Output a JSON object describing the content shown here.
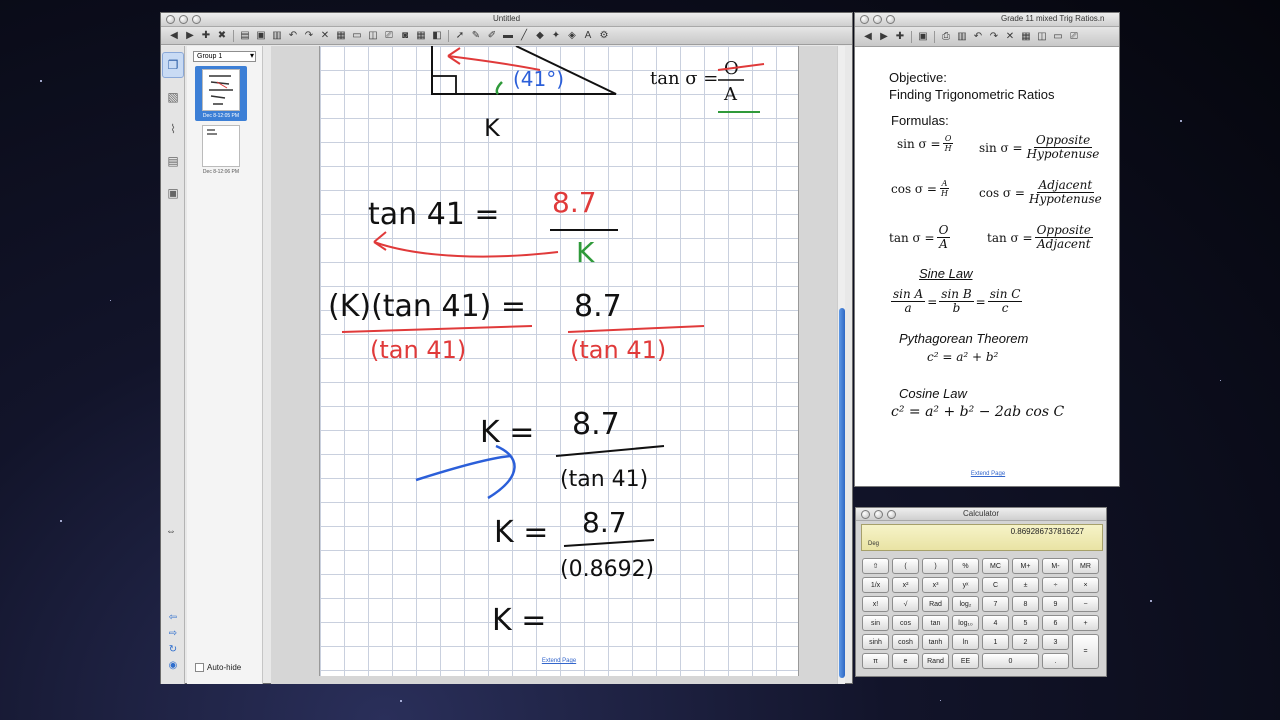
{
  "notebook": {
    "window_title": "Untitled",
    "group_label": "Group 1",
    "pages": [
      {
        "caption": "Dec 8-12:05 PM"
      },
      {
        "caption": "Dec 8-12:06 PM"
      }
    ],
    "auto_hide_label": "Auto-hide",
    "extend_page_label": "Extend Page",
    "handwriting": {
      "triangle_label": "K",
      "triangle_angle": "(41°)",
      "tan_label": "tan σ =",
      "tan_num": "O",
      "tan_den": "A",
      "step1_left": "tan 41 =",
      "step1_num": "8.7",
      "step1_den": "K",
      "step2_left": "(K)(tan 41) =",
      "step2_right": "8.7",
      "step2_under_left": "(tan 41)",
      "step2_under_right": "(tan 41)",
      "step3_left": "K =",
      "step3_num": "8.7",
      "step3_den": "(tan 41)",
      "step4_left": "K =",
      "step4_num": "8.7",
      "step4_den": "(0.8692)",
      "step5_left": "K ="
    }
  },
  "document": {
    "window_title": "Grade 11 mixed Trig Ratios.n",
    "objective_heading": "Objective:",
    "objective_text": "Finding Trigonometric Ratios",
    "formulas_heading": "Formulas:",
    "formulas": {
      "sin_short": {
        "lhs": "sin σ =",
        "num": "O",
        "den": "H"
      },
      "sin_long": {
        "lhs": "sin σ =",
        "num": "Opposite",
        "den": "Hypotenuse"
      },
      "cos_short": {
        "lhs": "cos σ =",
        "num": "A",
        "den": "H"
      },
      "cos_long": {
        "lhs": "cos σ =",
        "num": "Adjacent",
        "den": "Hypotenuse"
      },
      "tan_short": {
        "lhs": "tan σ =",
        "num": "O",
        "den": "A"
      },
      "tan_long": {
        "lhs": "tan σ =",
        "num": "Opposite",
        "den": "Adjacent"
      }
    },
    "sine_law_heading": "Sine Law",
    "sine_law": {
      "n1": "sin A",
      "d1": "a",
      "n2": "sin B",
      "d2": "b",
      "n3": "sin C",
      "d3": "c",
      "eq": "="
    },
    "pythagorean_heading": "Pythagorean Theorem",
    "pythagorean_formula": "c² = a² + b²",
    "cosine_law_heading": "Cosine Law",
    "cosine_law_formula": "c² = a² + b² − 2ab cos C",
    "extend_page_label": "Extend Page"
  },
  "calculator": {
    "title": "Calculator",
    "display_value": "0.869286737816227",
    "mode": "Deg",
    "keys": [
      "⇧",
      "(",
      ")",
      "%",
      "MC",
      "M+",
      "M-",
      "MR",
      "1/x",
      "x²",
      "x³",
      "yˣ",
      "C",
      "±",
      "÷",
      "×",
      "x!",
      "√",
      "Rad",
      "log₂",
      "7",
      "8",
      "9",
      "−",
      "sin",
      "cos",
      "tan",
      "log₁₀",
      "4",
      "5",
      "6",
      "+",
      "sinh",
      "cosh",
      "tanh",
      "ln",
      "1",
      "2",
      "3",
      "π",
      "e",
      "Rand",
      "EE",
      "0",
      ".",
      "="
    ]
  },
  "colors": {
    "ink_black": "#111111",
    "ink_red": "#e03a3a",
    "ink_blue": "#2b5fd9",
    "ink_green": "#2f9a3a",
    "accent_blue": "#3c7fd6"
  }
}
